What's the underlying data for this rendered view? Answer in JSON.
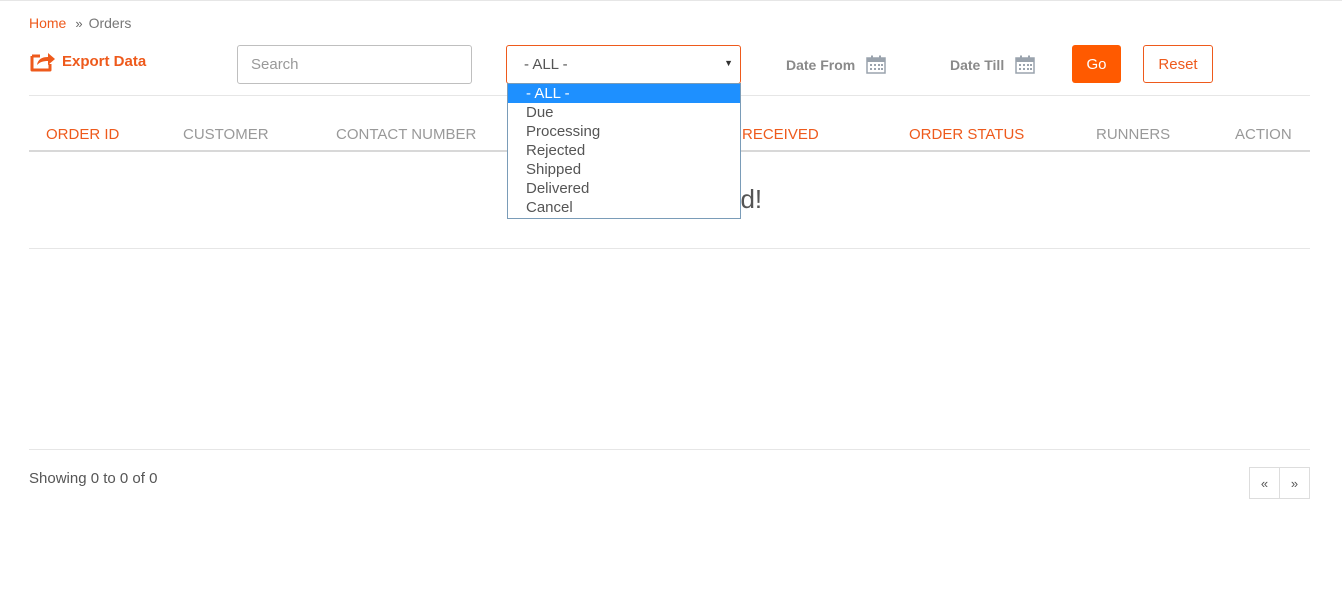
{
  "breadcrumb": {
    "home": "Home",
    "separator": "»",
    "current": "Orders"
  },
  "toolbar": {
    "export_label": "Export Data",
    "search_placeholder": "Search",
    "status_select": {
      "selected": "- ALL -",
      "options": [
        "- ALL -",
        "Due",
        "Processing",
        "Rejected",
        "Shipped",
        "Delivered",
        "Cancel"
      ]
    },
    "date_from_label": "Date From",
    "date_till_label": "Date Till",
    "go_label": "Go",
    "reset_label": "Reset"
  },
  "table": {
    "columns": [
      "ORDER ID",
      "CUSTOMER",
      "CONTACT NUMBER",
      "R RECEIVED",
      "ORDER STATUS",
      "RUNNERS",
      "ACTION"
    ],
    "empty_message": "nd!"
  },
  "footer": {
    "showing": "Showing 0 to 0 of 0",
    "prev": "«",
    "next": "»"
  },
  "colors": {
    "accent": "#ee5a1c",
    "button": "#ff5a00",
    "selected_option": "#1e90ff"
  }
}
